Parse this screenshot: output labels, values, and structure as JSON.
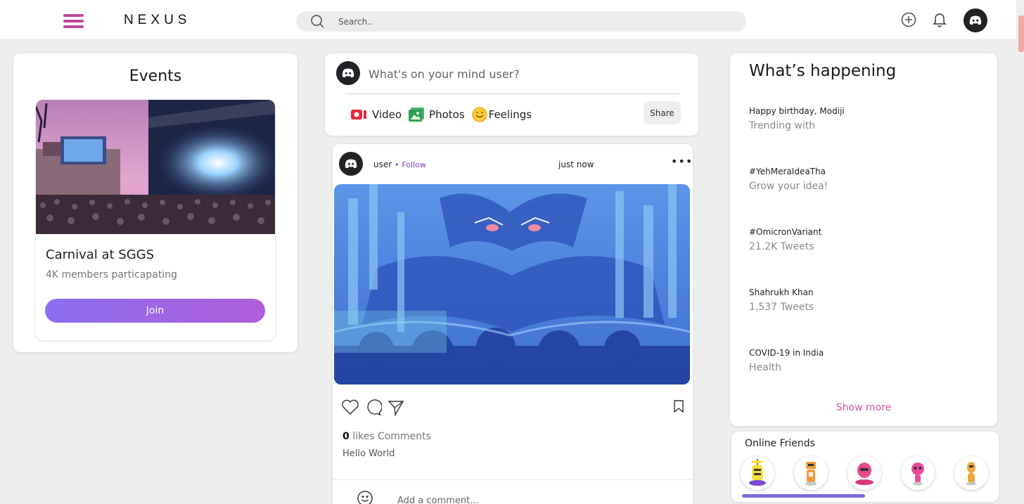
{
  "header": {
    "brand": "NEXUS",
    "search_placeholder": "Search..",
    "accent_color": "#c0479f",
    "icons": [
      "menu-icon",
      "search-icon",
      "add-circle-icon",
      "bell-icon",
      "discord-avatar-icon"
    ]
  },
  "events": {
    "title": "Events",
    "card": {
      "name": "Carnival at SGGS",
      "members": "4K members particapating",
      "join_label": "Join"
    }
  },
  "composer": {
    "placeholder": "What's on your mind user?",
    "actions": [
      {
        "label": "Video",
        "icon": "video-icon"
      },
      {
        "label": "Photos",
        "icon": "photos-icon"
      },
      {
        "label": "Feelings",
        "icon": "smiley-icon"
      }
    ],
    "share_label": "Share"
  },
  "post": {
    "user": "user",
    "separator": "•",
    "follow_label": "Follow",
    "time": "just now",
    "more": "•••",
    "likes_count": "0",
    "likes_label": " likes Comments",
    "caption": "Hello World",
    "comment_placeholder": "Add a comment..."
  },
  "trends": {
    "title": "What’s happening",
    "items": [
      {
        "name": "Happy birthday, Modiji",
        "sub": "Trending with"
      },
      {
        "name": "#YehMeraIdeaTha",
        "sub": "Grow your idea!"
      },
      {
        "name": "#OmicronVariant",
        "sub": "21.2K Tweets"
      },
      {
        "name": "Shahrukh Khan",
        "sub": "1,537 Tweets"
      },
      {
        "name": "COVID-19 in India",
        "sub": "Health"
      }
    ],
    "show_more": "Show more"
  },
  "friends": {
    "title": "Online Friends",
    "avatar_colors": [
      "#f2e13a",
      "#f29a3a",
      "#e84a8a",
      "#e8489b",
      "#f3a63c"
    ]
  }
}
